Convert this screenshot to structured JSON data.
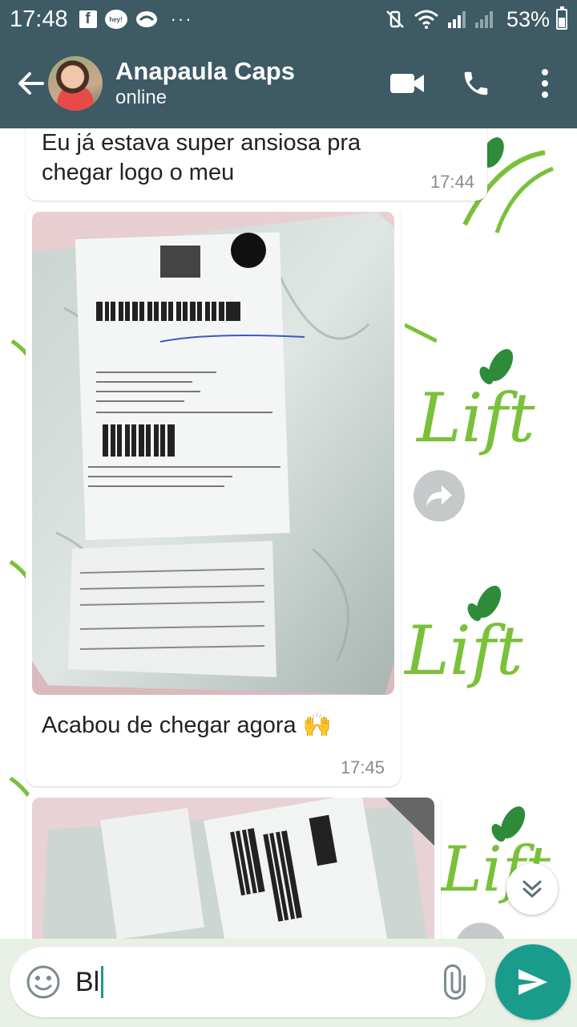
{
  "status_bar": {
    "time": "17:48",
    "battery_percent": "53%",
    "battery_level": 0.53,
    "overflow": "···"
  },
  "header": {
    "contact_name": "Anapaula Caps",
    "contact_status": "online"
  },
  "messages": [
    {
      "type": "text",
      "text_line1": "Eu já estava super ansiosa pra",
      "text_line2": "chegar logo o meu",
      "time": "17:44"
    },
    {
      "type": "image",
      "caption": "Acabou de chegar agora 🙌",
      "time": "17:45"
    },
    {
      "type": "image",
      "caption": "",
      "time": ""
    }
  ],
  "composer": {
    "value": "Bl"
  },
  "watermark": {
    "brand": "Lift",
    "color": "#7ac13a",
    "leaf_color": "#2e8b3a"
  },
  "colors": {
    "header": "#3d5a65",
    "accent": "#1a9c8d"
  },
  "icons": {
    "back": "arrow-left-icon",
    "video": "video-camera-icon",
    "call": "phone-icon",
    "menu": "more-vert-icon",
    "forward": "forward-share-icon",
    "scroll": "chevrons-down-icon",
    "emoji": "emoji-icon",
    "attach": "paperclip-icon",
    "send": "send-icon"
  }
}
